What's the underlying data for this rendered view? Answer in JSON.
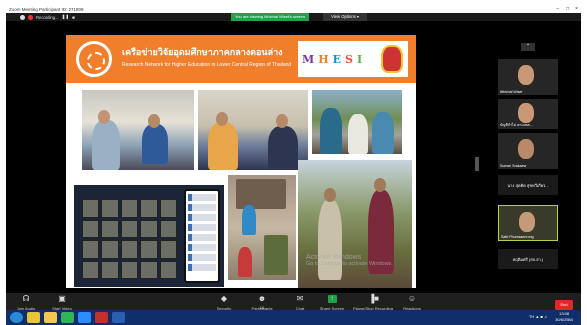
{
  "window": {
    "title": "Zoom Meeting Participant ID: 271809"
  },
  "topbar": {
    "recording_label": "Recording...",
    "share_notice": "You are viewing Itthichai Wiset's screen",
    "view_options": "View Options ▾"
  },
  "slide": {
    "title_th": "เครือข่ายวิจัยอุดมศึกษาภาคกลางตอนล่าง",
    "title_en": "Research Network for Higher Education in Lower Central Region of Thailand",
    "mhesi": [
      "M",
      "H",
      "E",
      "S",
      "I"
    ],
    "watermark_line1": "Activate Windows",
    "watermark_line2": "Go to Settings to activate Windows."
  },
  "participants": [
    {
      "name": "Itthichai Wiset"
    },
    {
      "name": "บัญชีจำไม่ ตามเหต..."
    },
    {
      "name": "Somsri Srakaew"
    },
    {
      "name": "นาง สุดคิด สุขทวีเกียร..."
    },
    {
      "name": "Satit Phumsaenrong"
    },
    {
      "name": "พฤติมศรี (สจ.สว.)"
    }
  ],
  "controls": [
    {
      "label": "Join Audio",
      "icon": "headphone-icon"
    },
    {
      "label": "Start Video",
      "icon": "video-icon"
    },
    {
      "label": "Security",
      "icon": "shield-icon"
    },
    {
      "label": "Participants",
      "icon": "people-icon",
      "count": "10"
    },
    {
      "label": "Chat",
      "icon": "chat-icon"
    },
    {
      "label": "Share Screen",
      "icon": "share-icon"
    },
    {
      "label": "Pause/Stop Recording",
      "icon": "record-icon"
    },
    {
      "label": "Reactions",
      "icon": "emoji-icon"
    }
  ],
  "end_button": "End",
  "taskbar": {
    "time": "13:08",
    "date": "30/6/2564",
    "tray": "TH  ▲  ■  ♫"
  }
}
